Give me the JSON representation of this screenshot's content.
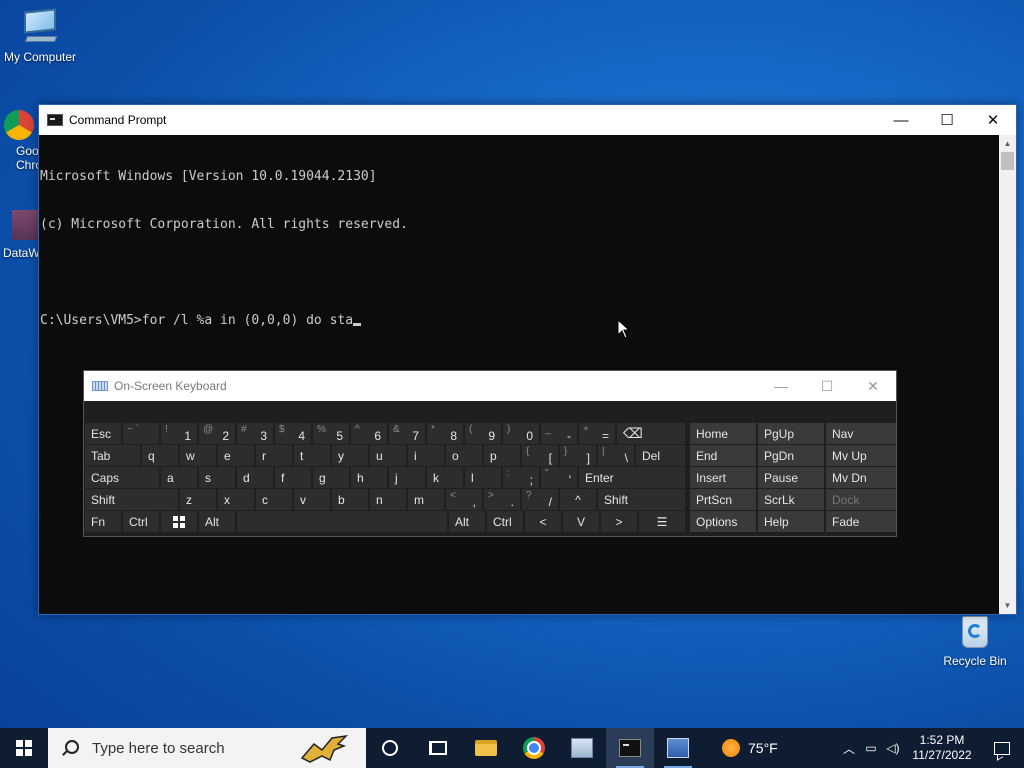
{
  "desktop": {
    "my_computer_label": "My Computer",
    "chrome_label_partial": "Goo Chro",
    "dataw_label_partial": "DataW",
    "recycle_bin_label": "Recycle Bin"
  },
  "cmd": {
    "title": "Command Prompt",
    "lines": [
      "Microsoft Windows [Version 10.0.19044.2130]",
      "(c) Microsoft Corporation. All rights reserved.",
      "",
      "C:\\Users\\VM5>for /l %a in (0,0,0) do sta"
    ],
    "minimize": "—",
    "maximize": "☐",
    "close": "✕"
  },
  "osk": {
    "title": "On-Screen Keyboard",
    "minimize": "—",
    "maximize": "☐",
    "close": "✕",
    "keys": {
      "esc": "Esc",
      "tilde_sub": "~ `",
      "k1_sub": "!",
      "k1": "1",
      "k2_sub": "@",
      "k2": "2",
      "k3_sub": "#",
      "k3": "3",
      "k4_sub": "$",
      "k4": "4",
      "k5_sub": "%",
      "k5": "5",
      "k6_sub": "^",
      "k6": "6",
      "k7_sub": "&",
      "k7": "7",
      "k8_sub": "*",
      "k8": "8",
      "k9_sub": "(",
      "k9": "9",
      "k0_sub": ")",
      "k0": "0",
      "minus_sub": "_",
      "minus": "-",
      "plus_sub": "+",
      "plus": "=",
      "backspace": "⌫",
      "tab": "Tab",
      "q": "q",
      "w": "w",
      "e": "e",
      "r": "r",
      "t": "t",
      "y": "y",
      "u": "u",
      "i": "i",
      "o": "o",
      "p": "p",
      "lbr_sub": "{",
      "lbr": "[",
      "rbr_sub": "}",
      "rbr": "]",
      "pipe_sub": "|",
      "pipe": "\\",
      "del": "Del",
      "caps": "Caps",
      "a": "a",
      "s": "s",
      "d": "d",
      "f": "f",
      "g": "g",
      "h": "h",
      "j": "j",
      "k": "k",
      "l": "l",
      "semi_sub": ":",
      "semi": ";",
      "quote_sub": "\"",
      "quote": "'",
      "enter": "Enter",
      "shift": "Shift",
      "z": "z",
      "x": "x",
      "c": "c",
      "v": "v",
      "b": "b",
      "n": "n",
      "m": "m",
      "comma_sub": "<",
      "comma": ",",
      "period_sub": ">",
      "period": ".",
      "slash_sub": "?",
      "slash": "/",
      "up": "^",
      "shift_r": "Shift",
      "fn": "Fn",
      "ctrl": "Ctrl",
      "alt": "Alt",
      "alt_r": "Alt",
      "ctrl_r": "Ctrl",
      "left": "<",
      "down": "V",
      "right": ">",
      "menu": "☰",
      "home": "Home",
      "pgup": "PgUp",
      "nav": "Nav",
      "end": "End",
      "pgdn": "PgDn",
      "mvup": "Mv Up",
      "insert": "Insert",
      "pause": "Pause",
      "mvdn": "Mv Dn",
      "prtscn": "PrtScn",
      "scrlk": "ScrLk",
      "dock": "Dock",
      "options": "Options",
      "help": "Help",
      "fade": "Fade"
    }
  },
  "taskbar": {
    "search_placeholder": "Type here to search",
    "weather": "75°F",
    "time": "1:52 PM",
    "date": "11/27/2022"
  }
}
